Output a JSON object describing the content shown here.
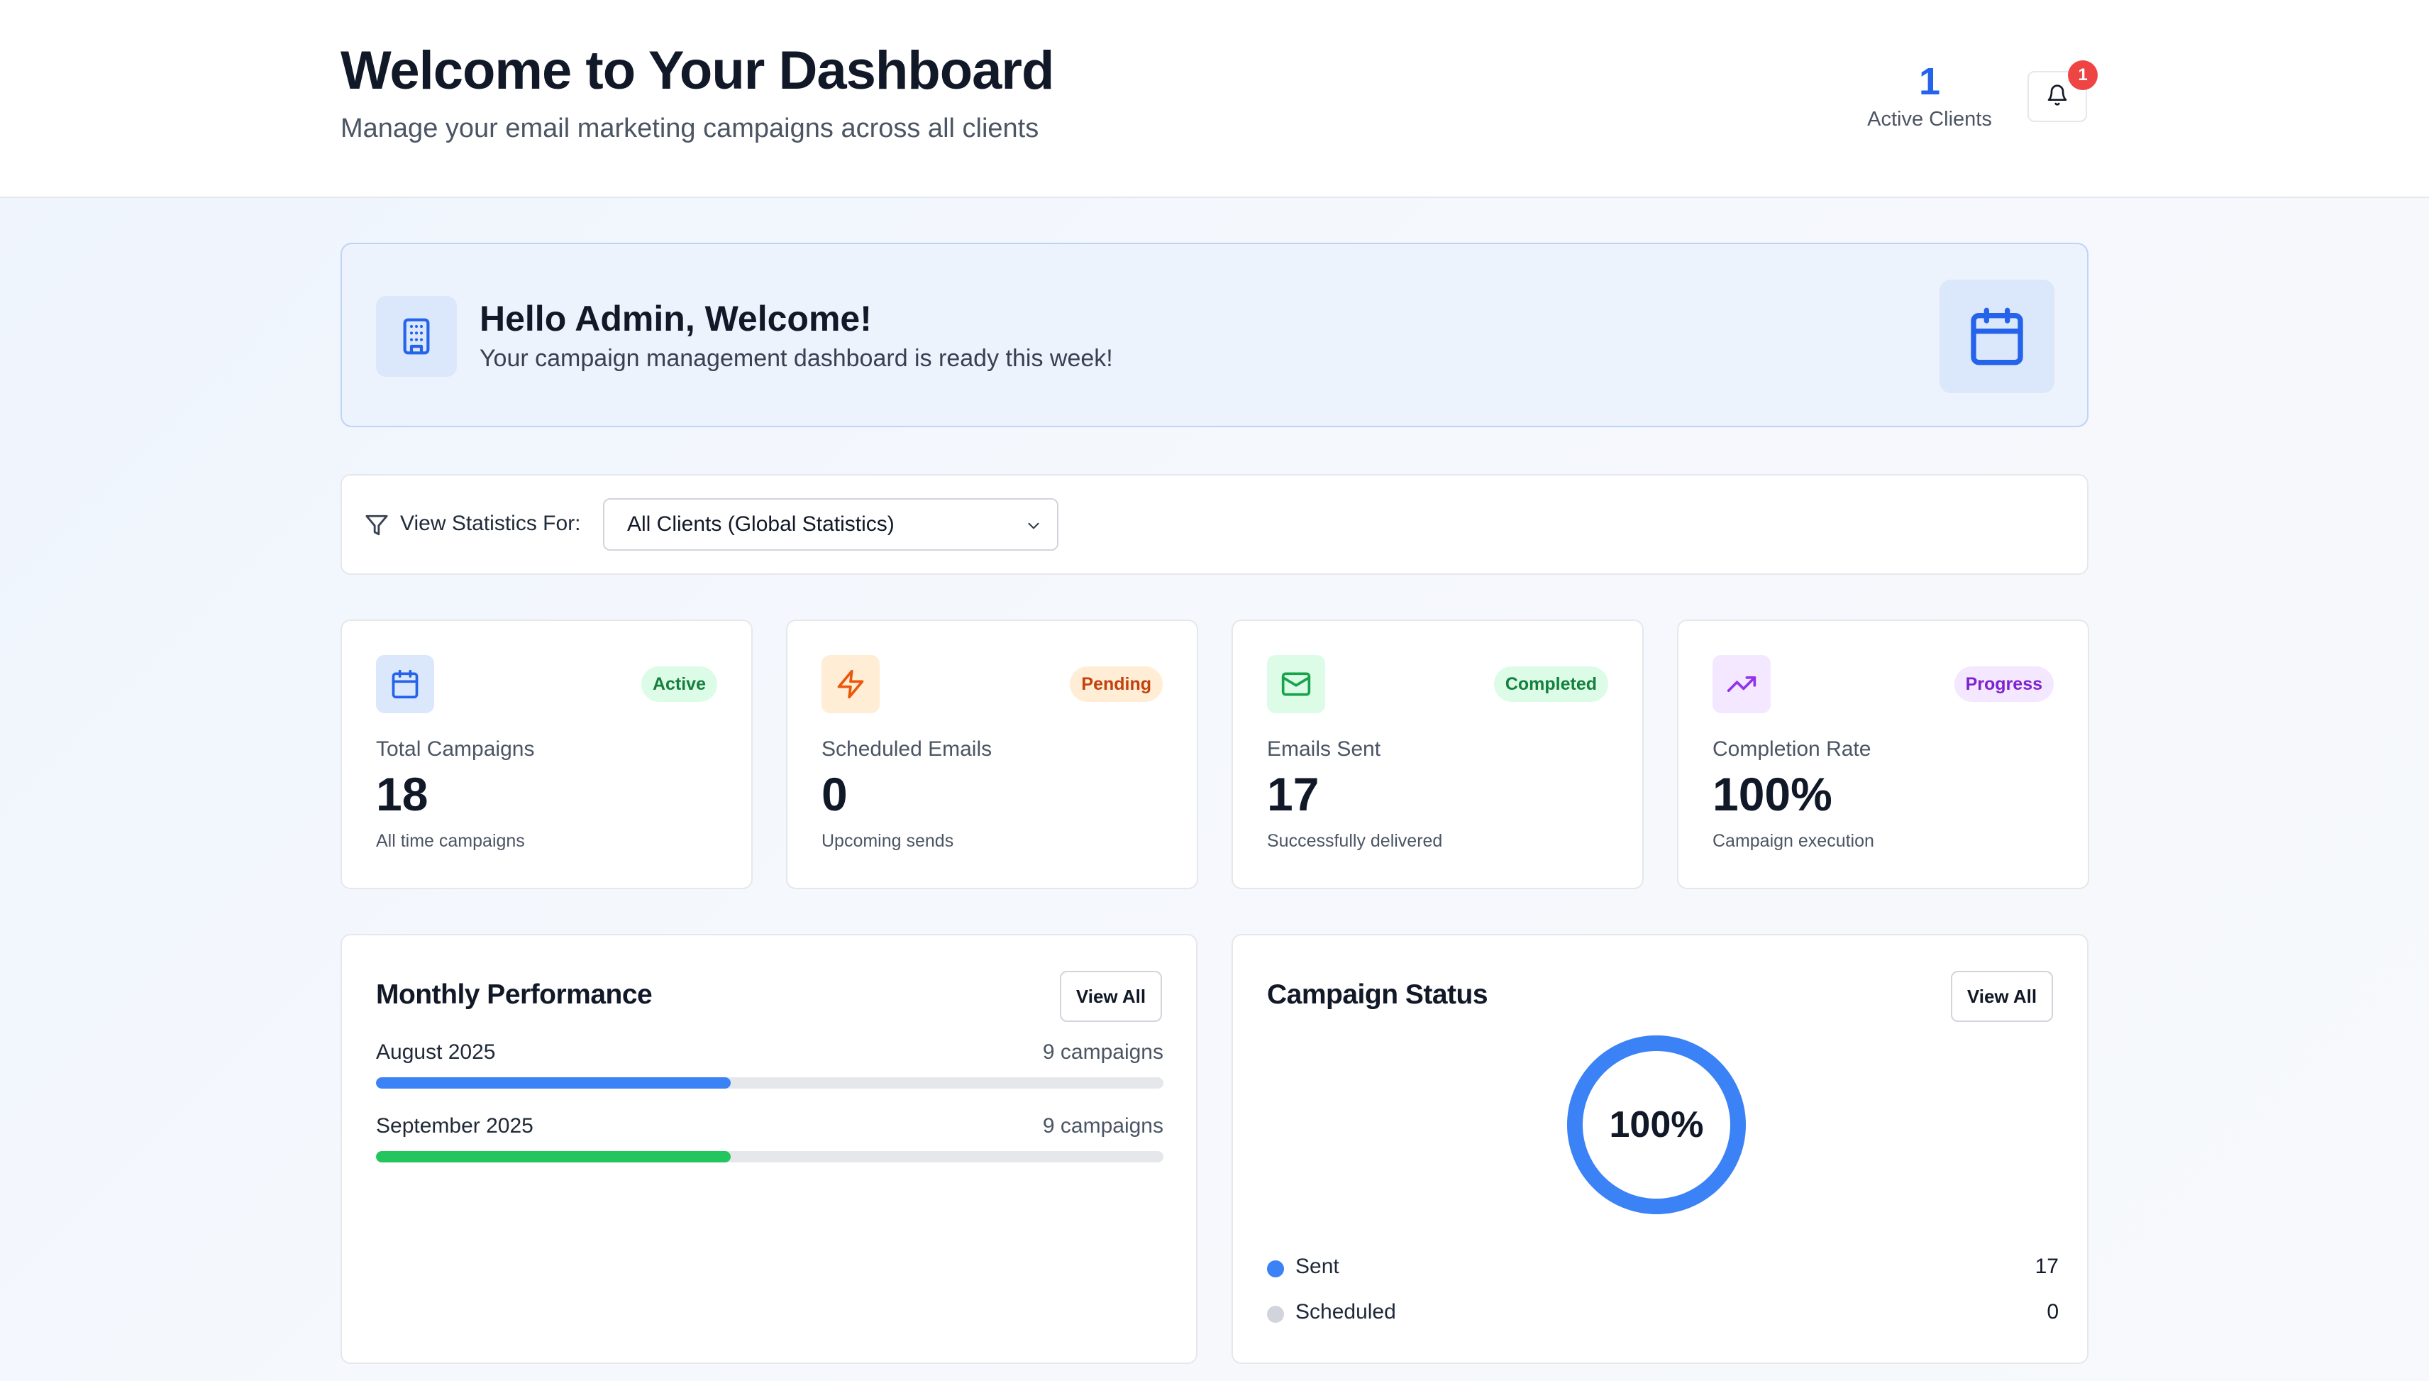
{
  "header": {
    "title": "Welcome to Your Dashboard",
    "subtitle": "Manage your email marketing campaigns across all clients",
    "active_clients_count": "1",
    "active_clients_label": "Active Clients",
    "notification_count": "1",
    "bell_icon": "bell-icon"
  },
  "welcome": {
    "icon": "building-icon",
    "title": "Hello Admin, Welcome!",
    "subtitle": "Your campaign management dashboard is ready this week!",
    "side_icon": "calendar-icon"
  },
  "filter": {
    "icon": "filter-icon",
    "label": "View Statistics For:",
    "selected": "All Clients (Global Statistics)"
  },
  "stats": [
    {
      "icon": "calendar-icon",
      "badge": "Active",
      "label": "Total Campaigns",
      "value": "18",
      "caption": "All time campaigns",
      "accent": "#2563eb",
      "icon_bg": "#dbe7fb",
      "badge_bg": "#dcfce7",
      "badge_color": "#15803d"
    },
    {
      "icon": "lightning-icon",
      "badge": "Pending",
      "label": "Scheduled Emails",
      "value": "0",
      "caption": "Upcoming sends",
      "accent": "#ea580c",
      "icon_bg": "#ffedd5",
      "badge_bg": "#ffedd5",
      "badge_color": "#c2410c"
    },
    {
      "icon": "mail-icon",
      "badge": "Completed",
      "label": "Emails Sent",
      "value": "17",
      "caption": "Successfully delivered",
      "accent": "#16a34a",
      "icon_bg": "#dcfce7",
      "badge_bg": "#dcfce7",
      "badge_color": "#15803d"
    },
    {
      "icon": "trending-up-icon",
      "badge": "Progress",
      "label": "Completion Rate",
      "value": "100%",
      "caption": "Campaign execution",
      "accent": "#9333ea",
      "icon_bg": "#f3e8ff",
      "badge_bg": "#f3e8ff",
      "badge_color": "#7e22ce"
    }
  ],
  "monthly": {
    "title": "Monthly Performance",
    "view_all": "View All",
    "rows": [
      {
        "name": "August 2025",
        "count": "9 campaigns",
        "progress": 0.45,
        "color": "#3b82f6"
      },
      {
        "name": "September 2025",
        "count": "9 campaigns",
        "progress": 0.45,
        "color": "#22c55e"
      }
    ]
  },
  "campaign_status": {
    "title": "Campaign Status",
    "view_all": "View All",
    "percent_label": "100%",
    "percent": 1.0,
    "legend": [
      {
        "name": "Sent",
        "value": "17",
        "color": "#3b82f6"
      },
      {
        "name": "Scheduled",
        "value": "0",
        "color": "#d1d5db"
      }
    ]
  }
}
